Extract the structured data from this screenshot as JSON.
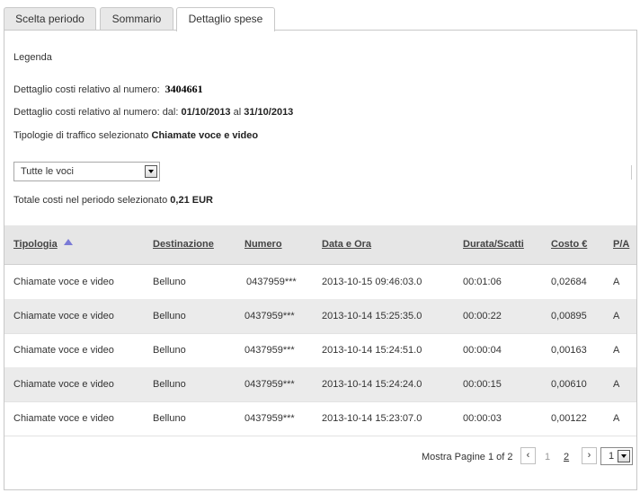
{
  "tabs": [
    {
      "label": "Scelta periodo",
      "active": false
    },
    {
      "label": "Sommario",
      "active": false
    },
    {
      "label": "Dettaglio spese",
      "active": true
    }
  ],
  "info": {
    "legend": "Legenda",
    "number_prefix": "Dettaglio costi relativo al numero:",
    "number_value": "3404661",
    "period_prefix": "Dettaglio costi relativo al numero: dal:",
    "period_from": "01/10/2013",
    "period_mid": "al",
    "period_to": "31/10/2013",
    "traffic_prefix": "Tipologie di traffico selezionato",
    "traffic_value": "Chiamate voce e video",
    "filter_value": "Tutte le voci",
    "total_prefix": "Totale costi nel periodo selezionato",
    "total_value": "0,21 EUR"
  },
  "table": {
    "headers": [
      "Tipologia",
      "Destinazione",
      "Numero",
      "Data e Ora",
      "Durata/Scatti",
      "Costo €",
      "P/A"
    ],
    "sorted_column": "Tipologia",
    "sort_direction": "ascending",
    "rows": [
      [
        "Chiamate voce e video",
        "Belluno",
        "0437959***",
        "2013-10-15 09:46:03.0",
        "00:01:06",
        "0,02684",
        "A"
      ],
      [
        "Chiamate voce e video",
        "Belluno",
        "0437959***",
        "2013-10-14 15:25:35.0",
        "00:00:22",
        "0,00895",
        "A"
      ],
      [
        "Chiamate voce e video",
        "Belluno",
        "0437959***",
        "2013-10-14 15:24:51.0",
        "00:00:04",
        "0,00163",
        "A"
      ],
      [
        "Chiamate voce e video",
        "Belluno",
        "0437959***",
        "2013-10-14 15:24:24.0",
        "00:00:15",
        "0,00610",
        "A"
      ],
      [
        "Chiamate voce e video",
        "Belluno",
        "0437959***",
        "2013-10-14 15:23:07.0",
        "00:00:03",
        "0,00122",
        "A"
      ]
    ]
  },
  "pager": {
    "label": "Mostra Pagine 1 of 2",
    "prev": "‹",
    "next": "›",
    "pages": [
      "1",
      "2"
    ],
    "current_page": "1",
    "select_value": "1"
  },
  "colors": {
    "header_bg": "#e6e6e6",
    "alt_row_bg": "#ebebeb",
    "sort_arrow": "#7a7ad6",
    "border": "#c8c8c8"
  }
}
